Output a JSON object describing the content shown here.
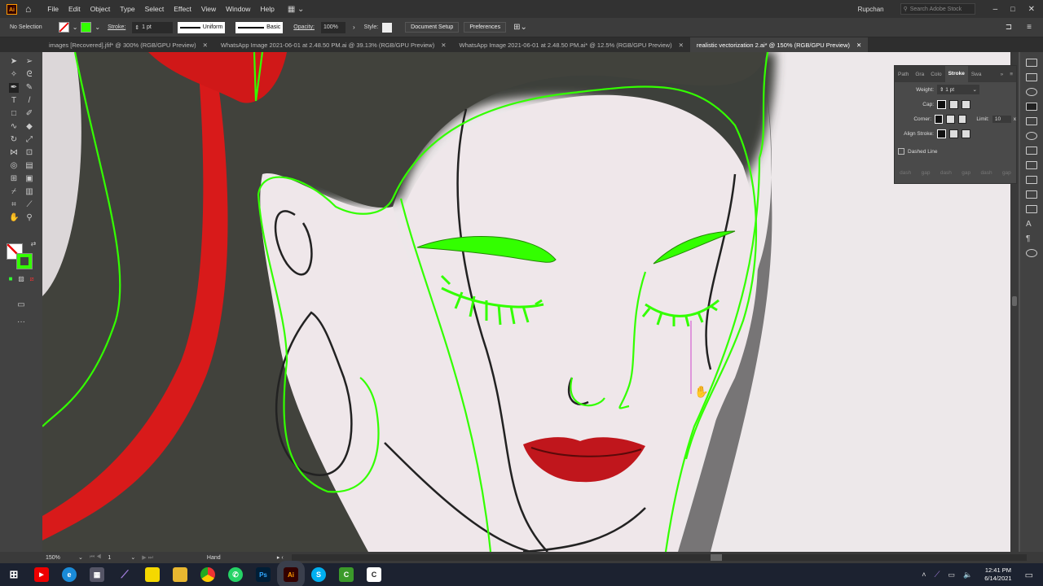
{
  "app": {
    "logo": "Ai",
    "user": "Rupchan",
    "search_placeholder": "Search Adobe Stock"
  },
  "menu": [
    "File",
    "Edit",
    "Object",
    "Type",
    "Select",
    "Effect",
    "View",
    "Window",
    "Help"
  ],
  "control": {
    "selection": "No Selection",
    "stroke_label": "Stroke:",
    "stroke_value": "1 pt",
    "profile": "Uniform",
    "brush": "Basic",
    "opacity_label": "Opacity:",
    "opacity_value": "100%",
    "style_label": "Style:",
    "doc_setup": "Document Setup",
    "preferences": "Preferences"
  },
  "tabs": [
    {
      "label": "images [Recovered].jfif* @ 300% (RGB/GPU Preview)",
      "active": false
    },
    {
      "label": "WhatsApp Image 2021-06-01 at 2.48.50 PM.ai @ 39.13% (RGB/GPU Preview)",
      "active": false
    },
    {
      "label": "WhatsApp Image 2021-06-01 at 2.48.50 PM.ai* @ 12.5% (RGB/GPU Preview)",
      "active": false
    },
    {
      "label": "realistic vectorization 2.ai* @ 150% (RGB/GPU Preview)",
      "active": true
    }
  ],
  "stroke_panel": {
    "tabs": [
      "Path",
      "Gra",
      "Colo",
      "Stroke",
      "Swa"
    ],
    "weight_label": "Weight:",
    "weight_value": "1 pt",
    "cap_label": "Cap:",
    "corner_label": "Corner:",
    "limit_label": "Limit:",
    "limit_value": "10",
    "limit_unit": "x",
    "align_label": "Align Stroke:",
    "dashed_label": "Dashed Line",
    "dash_labels": [
      "dash",
      "gap",
      "dash",
      "gap",
      "dash",
      "gap"
    ]
  },
  "status": {
    "zoom": "150%",
    "artboard": "1",
    "tool": "Hand"
  },
  "taskbar": {
    "time": "12:41 PM",
    "date": "6/14/2021"
  },
  "colors": {
    "accent_green": "#33ff00",
    "lip_red": "#c0161c"
  }
}
